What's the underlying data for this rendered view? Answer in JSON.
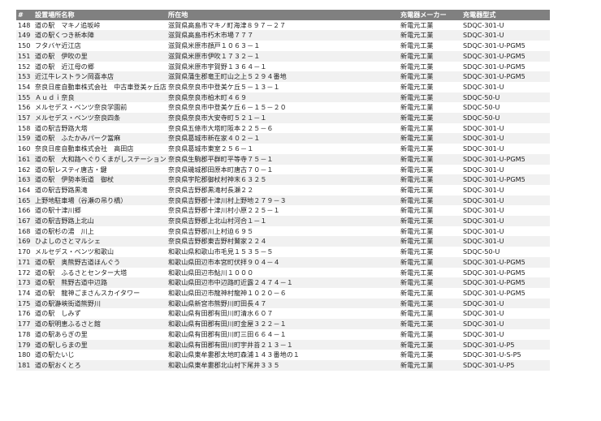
{
  "table": {
    "headers": [
      "#",
      "設置場所名称",
      "所在地",
      "充電器メーカー",
      "充電器型式"
    ],
    "rows": [
      [
        "148",
        "道の駅　マキノ追坂峠",
        "滋賀県高島市マキノ町海津８９７－２７",
        "新電元工業",
        "SDQC-301-U"
      ],
      [
        "149",
        "道の駅くつき新本陣",
        "滋賀県高島市朽木市場７７７",
        "新電元工業",
        "SDQC-301-U"
      ],
      [
        "150",
        "フタバヤ近江店",
        "滋賀県米原市顔戸１０６３－１",
        "新電元工業",
        "SDQC-301-U-PGM5"
      ],
      [
        "151",
        "道の駅　伊吹の里",
        "滋賀県米原市伊吹１７３２－１",
        "新電元工業",
        "SDQC-301-U-PGM5"
      ],
      [
        "152",
        "道の駅　近江母の郷",
        "滋賀県米原市宇賀野１３６４－１",
        "新電元工業",
        "SDQC-301-U-PGM5"
      ],
      [
        "153",
        "近江牛レストラン岡喜本店",
        "滋賀県蒲生郡竜王町山之上５２９４番地",
        "新電元工業",
        "SDQC-301-U-PGM5"
      ],
      [
        "154",
        "奈良日産自動車株式会社　中古車登美ヶ丘店",
        "奈良県奈良市中登美ケ丘５－１３－１",
        "新電元工業",
        "SDQC-301-U"
      ],
      [
        "155",
        "Ａｕｄｉ奈良",
        "奈良県奈良市柏木町４６９",
        "新電元工業",
        "SDQC-50-U"
      ],
      [
        "156",
        "メルセデス・ベンツ奈良学園前",
        "奈良県奈良市中登美ケ丘６－１５－２０",
        "新電元工業",
        "SDQC-50-U"
      ],
      [
        "157",
        "メルセデス・ベンツ奈良四条",
        "奈良県奈良市大安寺町５２１－１",
        "新電元工業",
        "SDQC-50-U"
      ],
      [
        "158",
        "道の駅吉野路大塔",
        "奈良県五條市大塔町阪本２２５－６",
        "新電元工業",
        "SDQC-301-U"
      ],
      [
        "159",
        "道の駅　ふたかみパーク當麻",
        "奈良県葛城市新在家４０２－１",
        "新電元工業",
        "SDQC-301-U"
      ],
      [
        "160",
        "奈良日産自動車株式会社　高田店",
        "奈良県葛城市東室２５６－１",
        "新電元工業",
        "SDQC-301-U"
      ],
      [
        "161",
        "道の駅　大和路へぐりくまがしステーション",
        "奈良県生駒郡平群町平等寺７５－１",
        "新電元工業",
        "SDQC-301-U-PGM5"
      ],
      [
        "162",
        "道の駅レスティ唐古・鍵",
        "奈良県磯城郡田原本町唐古７０－１",
        "新電元工業",
        "SDQC-301-U"
      ],
      [
        "163",
        "道の駅　伊勢本街道　御杖",
        "奈良県宇陀郡御杖村神末６３２５",
        "新電元工業",
        "SDQC-301-U-PGM5"
      ],
      [
        "164",
        "道の駅吉野路黒滝",
        "奈良県吉野郡黒滝村長瀬２２",
        "新電元工業",
        "SDQC-301-U"
      ],
      [
        "165",
        "上野地駐車場（谷瀬の吊り橋）",
        "奈良県吉野郡十津川村上野地２７９－３",
        "新電元工業",
        "SDQC-301-U"
      ],
      [
        "166",
        "道の駅十津川郷",
        "奈良県吉野郡十津川村小原２２５－１",
        "新電元工業",
        "SDQC-301-U"
      ],
      [
        "167",
        "道の駅吉野路上北山",
        "奈良県吉野郡上北山村河合１－１",
        "新電元工業",
        "SDQC-301-U"
      ],
      [
        "168",
        "道の駅杉の湯　川上",
        "奈良県吉野郡川上村迫６９５",
        "新電元工業",
        "SDQC-301-U"
      ],
      [
        "169",
        "ひよしのさとマルシェ",
        "奈良県吉野郡東吉野村鷲家２２４",
        "新電元工業",
        "SDQC-301-U"
      ],
      [
        "170",
        "メルセデス・ベンツ和歌山",
        "和歌山県和歌山市毛見１５３５－５",
        "新電元工業",
        "SDQC-50-U"
      ],
      [
        "171",
        "道の駅　奥熊野古道ほんぐう",
        "和歌山県田辺市本宮町伏拝９０４－４",
        "新電元工業",
        "SDQC-301-U-PGM5"
      ],
      [
        "172",
        "道の駅　ふるさとセンター大塔",
        "和歌山県田辺市鮎川１０００",
        "新電元工業",
        "SDQC-301-U-PGM5"
      ],
      [
        "173",
        "道の駅　熊野古道中辺路",
        "和歌山県田辺市中辺路町近露２４７４－１",
        "新電元工業",
        "SDQC-301-U-PGM5"
      ],
      [
        "174",
        "道の駅　龍神ごまさんスカイタワー",
        "和歌山県田辺市龍神村龍神１０２０－６",
        "新電元工業",
        "SDQC-301-U-PGM5"
      ],
      [
        "175",
        "道の駅瀞峡街道熊野川",
        "和歌山県新宮市熊野川町田長４７",
        "新電元工業",
        "SDQC-301-U"
      ],
      [
        "176",
        "道の駅　しみず",
        "和歌山県有田郡有田川町清水６０７",
        "新電元工業",
        "SDQC-301-U"
      ],
      [
        "177",
        "道の駅明恵ふるさと館",
        "和歌山県有田郡有田川町金屋３２２－１",
        "新電元工業",
        "SDQC-301-U"
      ],
      [
        "178",
        "道の駅あらぎの里",
        "和歌山県有田郡有田川町三田６６４－１",
        "新電元工業",
        "SDQC-301-U"
      ],
      [
        "179",
        "道の駅しらまの里",
        "和歌山県有田郡有田川町宇井苔２１３－１",
        "新電元工業",
        "SDQC-301-U-P5"
      ],
      [
        "180",
        "道の駅たいじ",
        "和歌山県東牟婁郡太地町森浦１４３番地の１",
        "新電元工業",
        "SDQC-301-U-S-P5"
      ],
      [
        "181",
        "道の駅おくとろ",
        "和歌山県東牟婁郡北山村下尾井３３５",
        "新電元工業",
        "SDQC-301-U-P5"
      ]
    ]
  }
}
